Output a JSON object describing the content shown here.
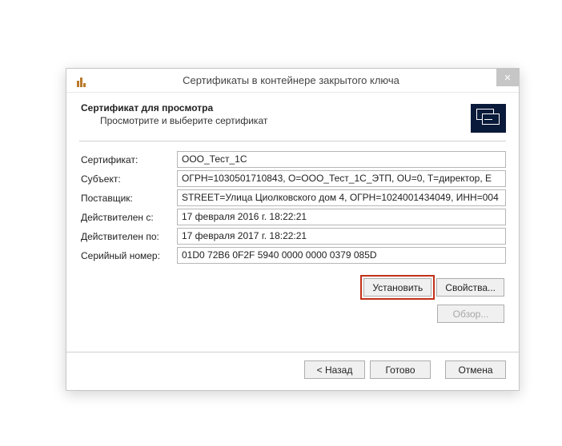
{
  "window": {
    "title": "Сертификаты в контейнере закрытого ключа",
    "close": "✕"
  },
  "header": {
    "title": "Сертификат для просмотра",
    "subtitle": "Просмотрите и выберите сертификат"
  },
  "fields": {
    "certificate": {
      "label": "Сертификат:",
      "value": "ООО_Тест_1С"
    },
    "subject": {
      "label": "Субъект:",
      "value": "ОГРН=1030501710843, O=ООО_Тест_1С_ЭТП, OU=0, T=директор, E"
    },
    "supplier": {
      "label": "Поставщик:",
      "value": "STREET=Улица Циолковского дом 4, ОГРН=1024001434049, ИНН=004"
    },
    "valid_from": {
      "label": "Действителен с:",
      "value": "17 февраля 2016 г. 18:22:21"
    },
    "valid_to": {
      "label": "Действителен по:",
      "value": "17 февраля 2017 г. 18:22:21"
    },
    "serial": {
      "label": "Серийный номер:",
      "value": "01D0 72B6 0F2F 5940 0000 0000 0379 085D"
    }
  },
  "buttons": {
    "install": "Установить",
    "properties": "Свойства...",
    "browse": "Обзор...",
    "back": "< Назад",
    "done": "Готово",
    "cancel": "Отмена"
  }
}
